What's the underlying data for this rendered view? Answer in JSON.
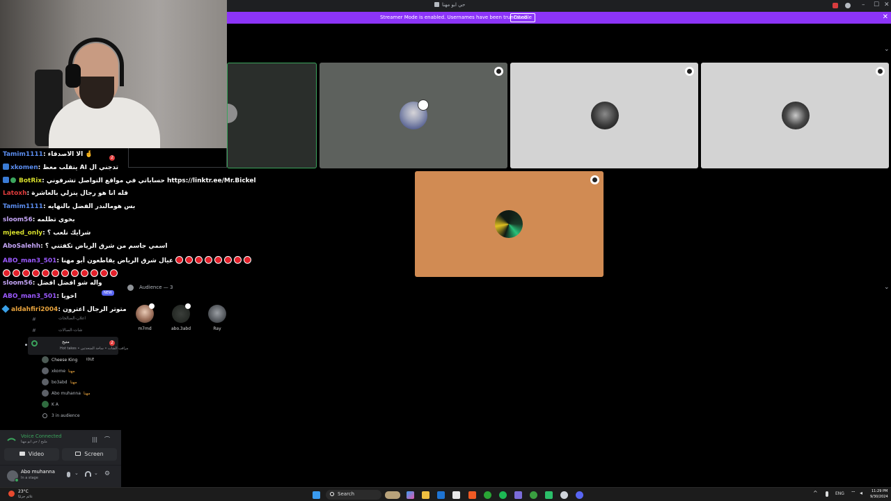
{
  "window": {
    "title": "حي ابو مهنا"
  },
  "banner": {
    "message": "Streamer Mode is enabled. Usernames have been truncated.",
    "disable_label": "Disable"
  },
  "chat": {
    "lines": [
      {
        "user": "Tamim1111",
        "text": ": الا الاصدقاء 🤞",
        "color": "#5b8def"
      },
      {
        "user": "xkomen",
        "text": ": يتقلب معظ AI تدجني ال",
        "color": "#5b8def"
      },
      {
        "user": "BotRix",
        "text": ": حساباتي في مواقع التواصل تشرفوني https://linktr.ee/Mr.Bickel",
        "color": "#d6de2b"
      },
      {
        "user": "Latoxh",
        "text": ": قله انا هو رجال ينزلي بالعاشرة",
        "color": "#e23c3c"
      },
      {
        "user": "Tamim1111",
        "text": ": بس هومالندر الفضل بالنهايه",
        "color": "#5b8def"
      },
      {
        "user": "sloom56",
        "text": ": بخوي تظلمه",
        "color": "#c3a4f5"
      },
      {
        "user": "mjeed_only",
        "text": ": شرايك نلعب ؟",
        "color": "#d6de2b"
      },
      {
        "user": "AboSalehh",
        "text": ": اسمي جاسم من شرق الرياض تكفتني ؟",
        "color": "#c3a4f5"
      },
      {
        "user": "ABO_man3_501",
        "text": ": عيال شرق الرياض يقاطعون أبو مهنا",
        "color": "#9b59ff"
      },
      {
        "user": "sloom56",
        "text": ": واله شو افضل افضل",
        "color": "#c3a4f5"
      },
      {
        "user": "ABO_man3_501",
        "text": ": اخويا",
        "color": "#9b59ff"
      },
      {
        "user": "aldahfiri2004",
        "text": ": متوتر الرجال اعترون",
        "color": "#e8a33d"
      }
    ],
    "new_badge": "NEW",
    "badge_count": "2"
  },
  "stage": {
    "audience_header": "Audience — 3",
    "audience": [
      {
        "name": "m7md"
      },
      {
        "name": "abo.3abd"
      },
      {
        "name": "Ray"
      }
    ],
    "tile_colors": {
      "dark_green": "#2a2e2b",
      "gray": "#5d615d",
      "light": "#d3d3d3",
      "orange": "#d18b53"
    }
  },
  "sidebar": {
    "channels": [
      "اعلان-الصالحات",
      "شات-الصالات"
    ],
    "active_channel": {
      "name": "متيح",
      "subtitle": "Hot takes • مراقب الشات • ساحة المتحدثين",
      "badge": "2"
    },
    "members": [
      {
        "name": "Cheese King",
        "tag": "IDLE"
      },
      {
        "name": "xkome",
        "tag": "مهنا"
      },
      {
        "name": "bo3abd",
        "tag": "مهنا"
      },
      {
        "name": "Abo muhanna",
        "tag": "مهنا"
      },
      {
        "name": "K A",
        "tag": ""
      }
    ],
    "in_audience": "3 in audience"
  },
  "voice": {
    "status": "Voice Connected",
    "channel": "مليح / حي ابو مهنا",
    "video_label": "Video",
    "screen_label": "Screen"
  },
  "user": {
    "name": "Abo muhanna",
    "status": "In a stage"
  },
  "taskbar": {
    "weather_temp": "23°C",
    "weather_desc": "غائم جزئيًا",
    "search_label": "Search",
    "lang": "ENG",
    "time": "11:29 PM",
    "date": "9/30/2024"
  }
}
